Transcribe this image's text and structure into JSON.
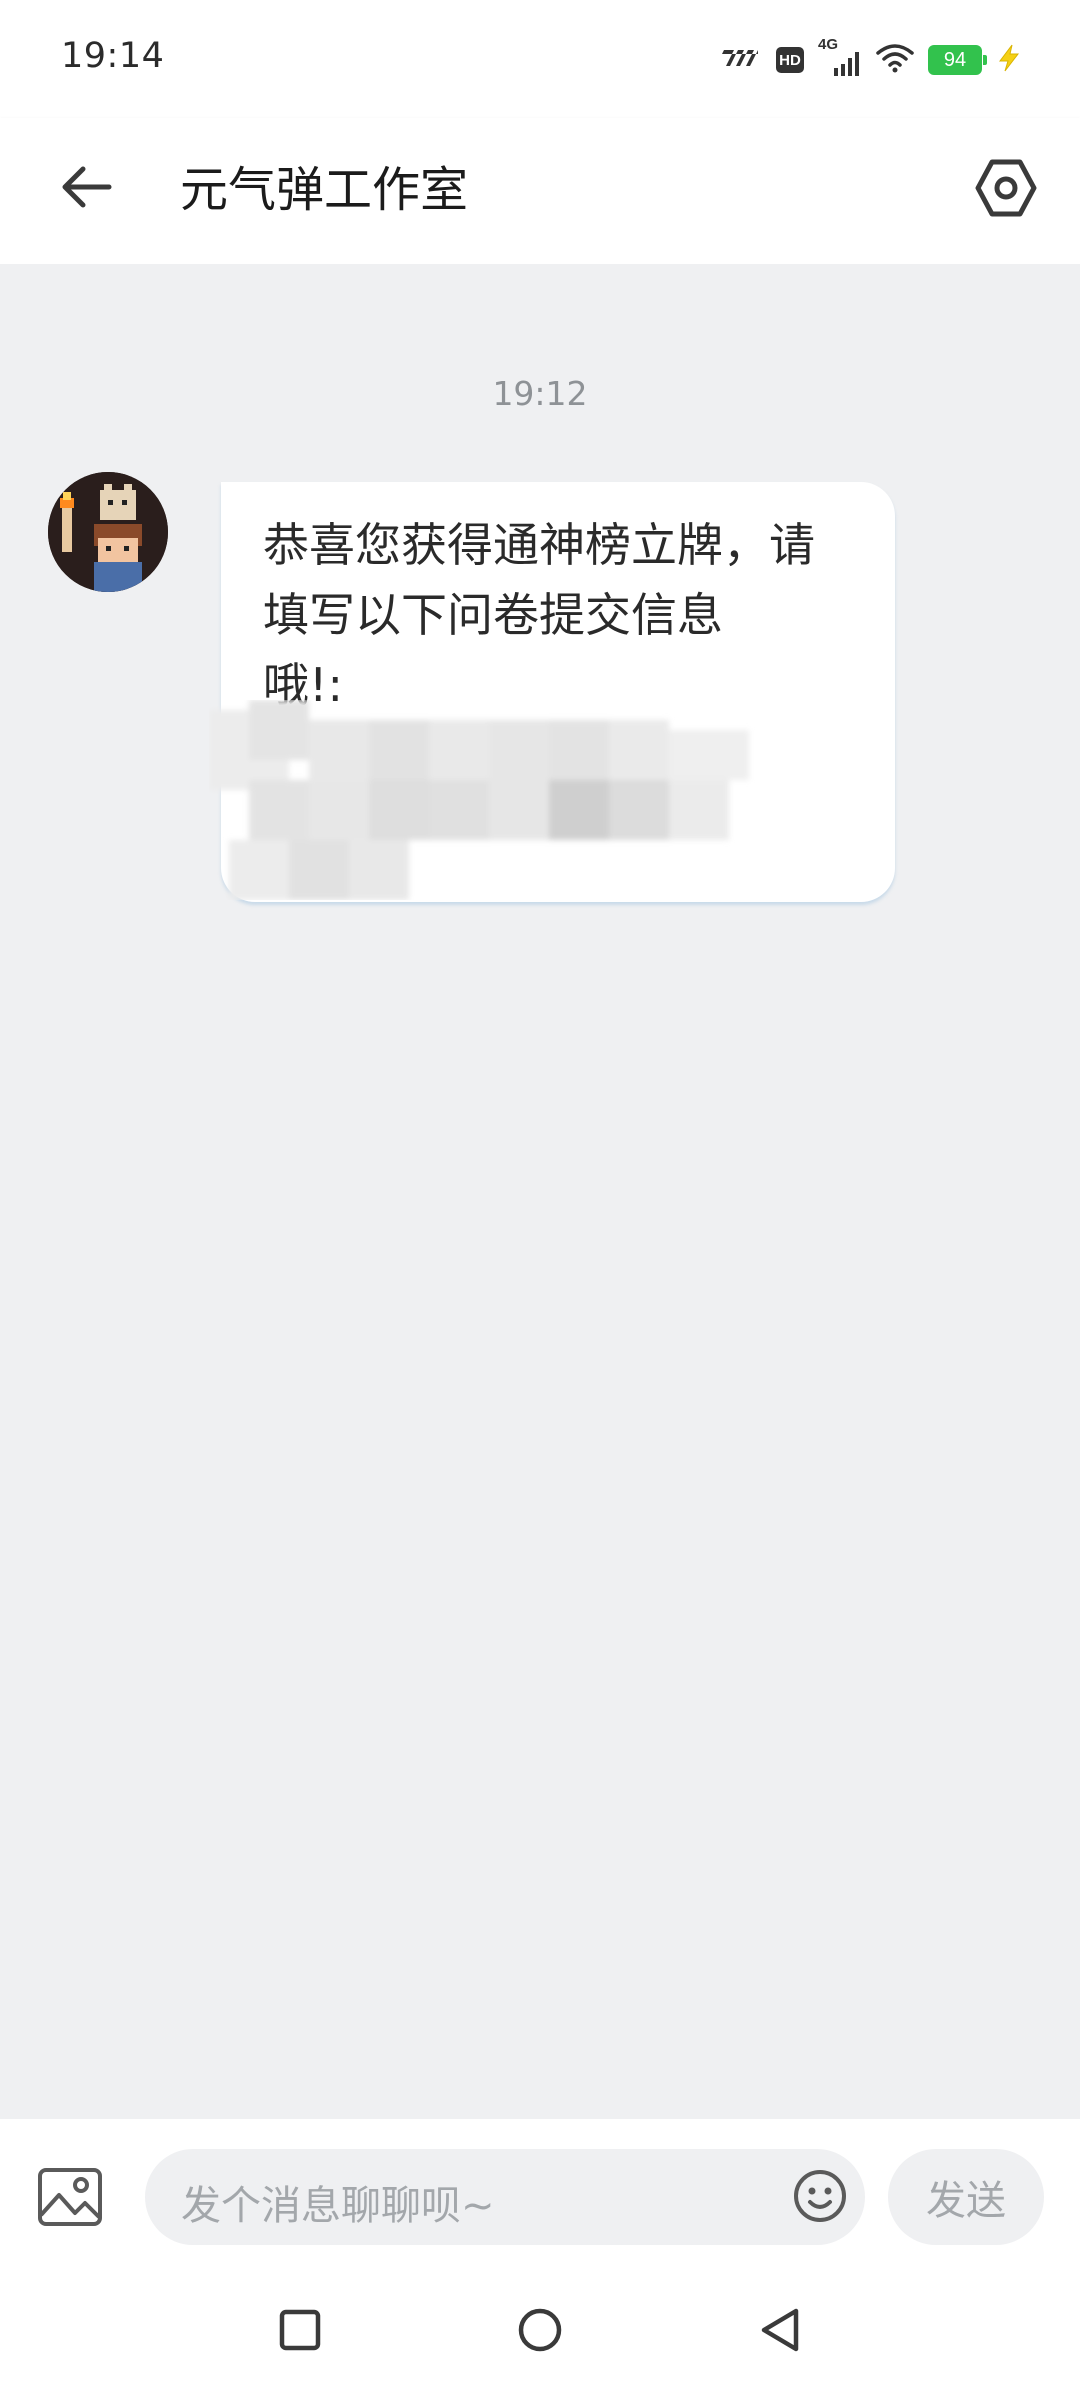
{
  "status_bar": {
    "time": "19:14",
    "hd_label": "HD",
    "network_label": "4G",
    "battery_level": "94"
  },
  "header": {
    "title": "元气弹工作室",
    "icons": {
      "back": "back-arrow-icon",
      "settings": "settings-hexagon-icon"
    }
  },
  "chat": {
    "timestamp": "19:12",
    "messages": [
      {
        "sender": "incoming",
        "lines": [
          "恭喜您获得通神榜立牌，请",
          "填写以下问卷提交信息",
          "哦!:"
        ],
        "has_redacted_link": true
      }
    ]
  },
  "input_bar": {
    "placeholder": "发个消息聊聊呗~",
    "send_label": "发送",
    "icons": {
      "image": "image-icon",
      "emoji": "emoji-icon"
    }
  },
  "nav_bar": {
    "icons": [
      "recents-square-icon",
      "home-circle-icon",
      "back-triangle-icon"
    ]
  },
  "colors": {
    "chat_background": "#eff0f2",
    "bubble": "#ffffff",
    "battery": "#32c24d",
    "placeholder_text": "#a3a7ab"
  }
}
